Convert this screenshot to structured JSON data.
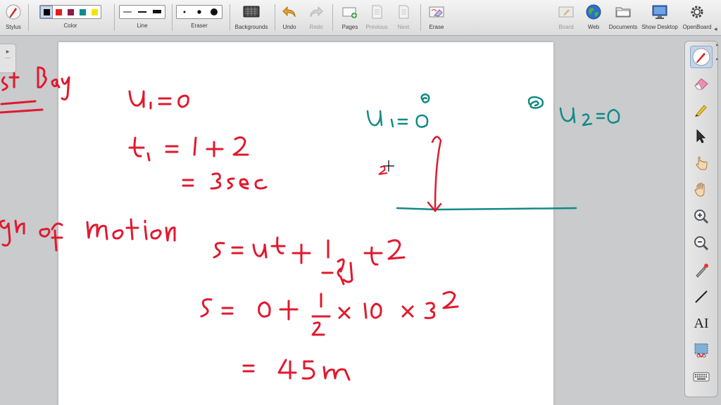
{
  "toolbar": {
    "stylus": "Stylus",
    "color": "Color",
    "line": "Line",
    "eraser": "Eraser",
    "backgrounds": "Backgrounds",
    "undo": "Undo",
    "redo": "Redo",
    "pages": "Pages",
    "previous": "Previous",
    "next": "Next",
    "erase": "Erase",
    "board": "Board",
    "web": "Web",
    "documents": "Documents",
    "show_desktop": "Show Desktop",
    "openboard": "OpenBoard"
  },
  "palette_colors": [
    "#000000",
    "#e81919",
    "#8e1b4a",
    "#0f8a8a",
    "#f2e600"
  ],
  "selected_color_index": 0,
  "ink_colors": {
    "red": "#e0192e",
    "teal": "#128a86"
  },
  "notes": {
    "red": {
      "top_left": "st Bay",
      "u1": "u₁ = 0",
      "t1": "t₁ = 1 + 2",
      "t1_result": "= 3sec",
      "motion": "gh of motion",
      "eq1": "s = ut + ½gt²",
      "eq2": "s = 0 + ½ × 10 × 3²",
      "eq3": "= 45m"
    },
    "teal": {
      "u1": "u₁ = 0",
      "u2": "u₂ = 0"
    }
  },
  "rightbar_tools": [
    "pen-tool",
    "eraser-tool",
    "highlighter-tool",
    "pointer-tool",
    "interact-tool",
    "hand-tool",
    "zoom-in-tool",
    "zoom-out-tool",
    "laser-tool",
    "line-tool",
    "text-tool",
    "capture-tool",
    "keyboard-tool"
  ],
  "rightbar_text_tool": "AI"
}
